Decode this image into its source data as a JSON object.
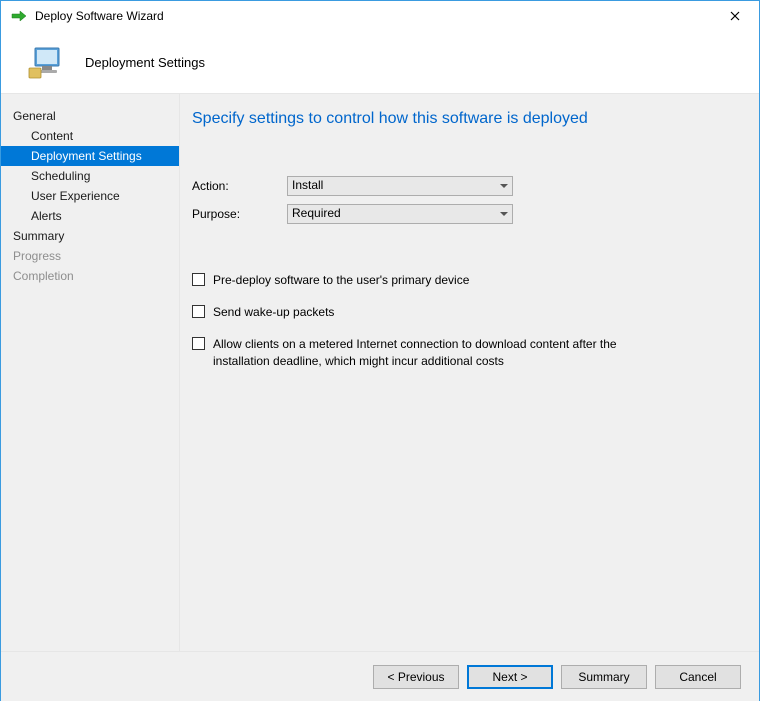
{
  "window": {
    "title": "Deploy Software Wizard"
  },
  "header": {
    "title": "Deployment Settings"
  },
  "sidebar": {
    "items": [
      {
        "label": "General",
        "indent": false,
        "active": false,
        "disabled": false
      },
      {
        "label": "Content",
        "indent": true,
        "active": false,
        "disabled": false
      },
      {
        "label": "Deployment Settings",
        "indent": true,
        "active": true,
        "disabled": false
      },
      {
        "label": "Scheduling",
        "indent": true,
        "active": false,
        "disabled": false
      },
      {
        "label": "User Experience",
        "indent": true,
        "active": false,
        "disabled": false
      },
      {
        "label": "Alerts",
        "indent": true,
        "active": false,
        "disabled": false
      },
      {
        "label": "Summary",
        "indent": false,
        "active": false,
        "disabled": false
      },
      {
        "label": "Progress",
        "indent": false,
        "active": false,
        "disabled": true
      },
      {
        "label": "Completion",
        "indent": false,
        "active": false,
        "disabled": true
      }
    ]
  },
  "main": {
    "heading": "Specify settings to control how this software is deployed",
    "form": {
      "action_label": "Action:",
      "action_value": "Install",
      "purpose_label": "Purpose:",
      "purpose_value": "Required"
    },
    "checkboxes": [
      {
        "label": "Pre-deploy software to the user's primary device",
        "checked": false
      },
      {
        "label": "Send wake-up packets",
        "checked": false
      },
      {
        "label": "Allow clients on a metered Internet connection to download content after the installation deadline, which might incur additional costs",
        "checked": false
      }
    ]
  },
  "footer": {
    "previous": "< Previous",
    "next": "Next >",
    "summary": "Summary",
    "cancel": "Cancel"
  }
}
